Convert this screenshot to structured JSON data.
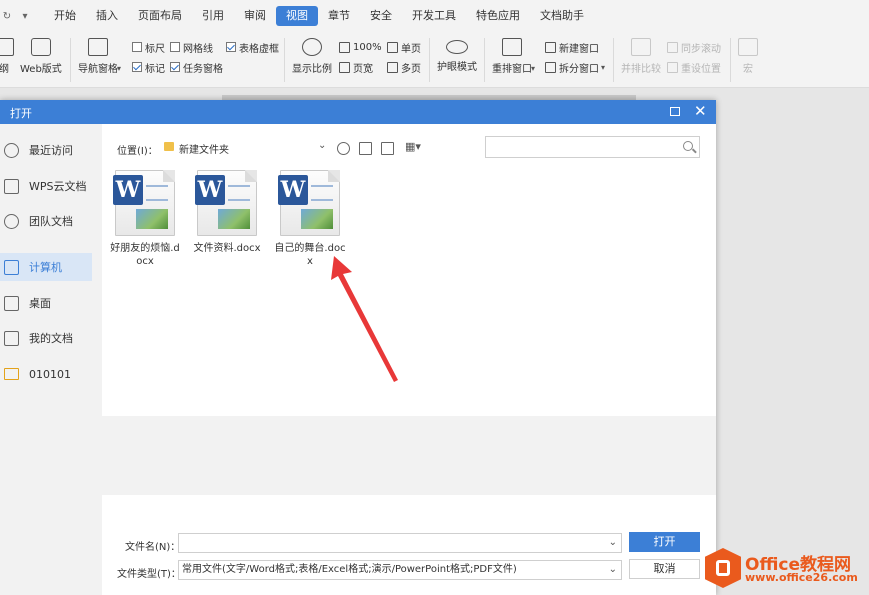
{
  "menubar": {
    "tabs": [
      "开始",
      "插入",
      "页面布局",
      "引用",
      "审阅",
      "视图",
      "章节",
      "安全",
      "开发工具",
      "特色应用",
      "文档助手"
    ],
    "active_tab": "视图"
  },
  "ribbon": {
    "outline_label": "纲",
    "web_layout": "Web版式",
    "nav_pane": "导航窗格",
    "ruler": "标尺",
    "gridlines": "网格线",
    "table_gridlines": "表格虚框",
    "markup": "标记",
    "task_pane": "任务窗格",
    "zoom_ratio": "显示比例",
    "zoom_100": "100%",
    "page_width": "页宽",
    "single_page": "单页",
    "multi_page": "多页",
    "eye_protect": "护眼模式",
    "rearrange_window": "重排窗口",
    "new_window": "新建窗口",
    "split_window": "拆分窗口",
    "side_by_side": "并排比较",
    "sync_scroll": "同步滚动",
    "reset_position": "重设位置",
    "macro": "宏"
  },
  "dialog": {
    "title": "打开",
    "sidebar": [
      "最近访问",
      "WPS云文档",
      "团队文档",
      "计算机",
      "桌面",
      "我的文档",
      "010101"
    ],
    "location_label": "位置(I)：",
    "location_value": "新建文件夹",
    "search_placeholder": "",
    "files": [
      {
        "name": "好朋友的烦恼.docx"
      },
      {
        "name": "文件资料.docx"
      },
      {
        "name": "自己的舞台.docx"
      }
    ],
    "filename_label": "文件名(N)：",
    "filename_value": "",
    "filetype_label": "文件类型(T)：",
    "filetype_value": "常用文件(文字/Word格式;表格/Excel格式;演示/PowerPoint格式;PDF文件)",
    "open_button": "打开",
    "cancel_button": "取消"
  },
  "watermark": {
    "title": "Office教程网",
    "url": "www.office26.com"
  },
  "colors": {
    "accent": "#3c7fd6",
    "annotation_arrow": "#e83838",
    "watermark": "#ea5a1d"
  }
}
